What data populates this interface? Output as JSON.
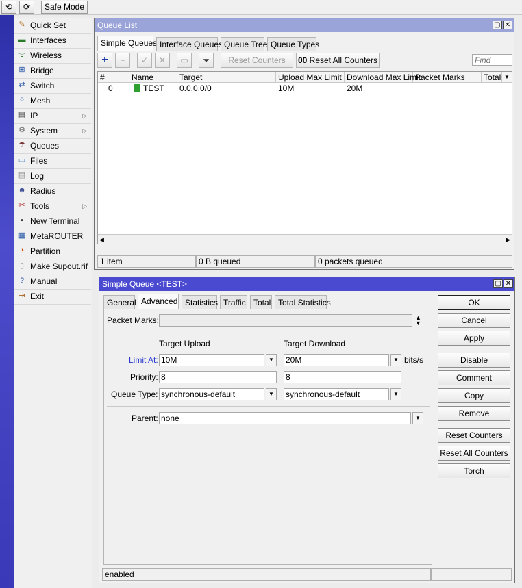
{
  "toolbar": {
    "undo_icon": "undo-icon",
    "redo_icon": "redo-icon",
    "safe_mode": "Safe Mode"
  },
  "sidebar": {
    "items": [
      {
        "label": "Quick Set",
        "icon": "quick-set-icon",
        "glyph": "✎",
        "color": "#b07020"
      },
      {
        "label": "Interfaces",
        "icon": "interfaces-icon",
        "glyph": "▬",
        "color": "#2a7a2a"
      },
      {
        "label": "Wireless",
        "icon": "wireless-icon",
        "glyph": "ᯤ",
        "color": "#2a7a2a"
      },
      {
        "label": "Bridge",
        "icon": "bridge-icon",
        "glyph": "⊞",
        "color": "#2a5aa8"
      },
      {
        "label": "Switch",
        "icon": "switch-icon",
        "glyph": "⇄",
        "color": "#2a5aa8"
      },
      {
        "label": "Mesh",
        "icon": "mesh-icon",
        "glyph": "⁘",
        "color": "#2a5aa8"
      },
      {
        "label": "IP",
        "icon": "ip-icon",
        "glyph": "▤",
        "color": "#555555",
        "arrow": "▷"
      },
      {
        "label": "System",
        "icon": "system-icon",
        "glyph": "⚙",
        "color": "#666666",
        "arrow": "▷"
      },
      {
        "label": "Queues",
        "icon": "queues-icon",
        "glyph": "☂",
        "color": "#7a3a3a"
      },
      {
        "label": "Files",
        "icon": "files-icon",
        "glyph": "▭",
        "color": "#4a8ac8"
      },
      {
        "label": "Log",
        "icon": "log-icon",
        "glyph": "▤",
        "color": "#888888"
      },
      {
        "label": "Radius",
        "icon": "radius-icon",
        "glyph": "☻",
        "color": "#445599"
      },
      {
        "label": "Tools",
        "icon": "tools-icon",
        "glyph": "✂",
        "color": "#aa2222",
        "arrow": "▷"
      },
      {
        "label": "New Terminal",
        "icon": "terminal-icon",
        "glyph": "▪",
        "color": "#333333"
      },
      {
        "label": "MetaROUTER",
        "icon": "metarouter-icon",
        "glyph": "▦",
        "color": "#2a5aa8"
      },
      {
        "label": "Partition",
        "icon": "partition-icon",
        "glyph": "◔",
        "color": "#cc4400"
      },
      {
        "label": "Make Supout.rif",
        "icon": "supout-icon",
        "glyph": "▯",
        "color": "#777777"
      },
      {
        "label": "Manual",
        "icon": "manual-icon",
        "glyph": "?",
        "color": "#1a4aa8"
      },
      {
        "label": "Exit",
        "icon": "exit-icon",
        "glyph": "⇥",
        "color": "#aa6622"
      }
    ]
  },
  "queue_list": {
    "title": "Queue List",
    "tabs": [
      "Simple Queues",
      "Interface Queues",
      "Queue Tree",
      "Queue Types"
    ],
    "buttons": {
      "reset_counters": "Reset Counters",
      "reset_all_counters": "Reset All Counters",
      "oo": "00"
    },
    "find_placeholder": "Find",
    "columns": [
      "#",
      "",
      "Name",
      "Target",
      "Upload Max Limit",
      "Download Max Limit",
      "Packet Marks",
      "Total"
    ],
    "rows": [
      {
        "num": "0",
        "name": "TEST",
        "target": "0.0.0.0/0",
        "upload": "10M",
        "download": "20M"
      }
    ],
    "status": {
      "items": "1 item",
      "queued_bytes": "0 B queued",
      "queued_packets": "0 packets queued"
    }
  },
  "simple_queue": {
    "title": "Simple Queue <TEST>",
    "tabs": [
      "General",
      "Advanced",
      "Statistics",
      "Traffic",
      "Total",
      "Total Statistics"
    ],
    "packet_marks_label": "Packet Marks:",
    "target_upload_header": "Target Upload",
    "target_download_header": "Target Download",
    "limit_at_label": "Limit At:",
    "limit_at_upload": "10M",
    "limit_at_download": "20M",
    "units": "bits/s",
    "priority_label": "Priority:",
    "priority_upload": "8",
    "priority_download": "8",
    "queue_type_label": "Queue Type:",
    "queue_type_upload": "synchronous-default",
    "queue_type_download": "synchronous-default",
    "parent_label": "Parent:",
    "parent_value": "none",
    "actions": [
      "OK",
      "Cancel",
      "Apply",
      "Disable",
      "Comment",
      "Copy",
      "Remove",
      "Reset Counters",
      "Reset All Counters",
      "Torch"
    ],
    "status": "enabled"
  },
  "colors": {
    "titlebar_active": "#4a4ad0",
    "titlebar_inactive": "#9aa4d8",
    "limit_label": "#2a3ad0"
  }
}
